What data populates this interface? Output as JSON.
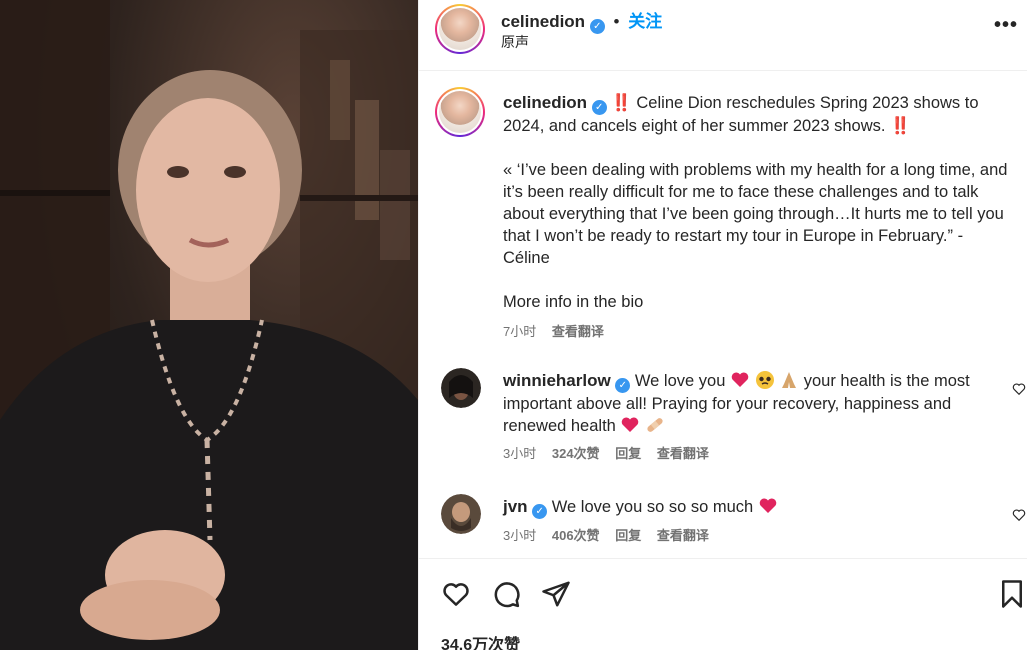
{
  "post": {
    "username": "celinedion",
    "follow_label": "关注",
    "audio_label": "原声",
    "caption_line1": "‼️ Celine Dion reschedules Spring 2023 shows to 2024, and cancels eight of her summer 2023 shows. ‼️",
    "caption_quote": "« ‘I’ve been dealing with problems with my health for a long time, and it’s been really difficult for me to face these challenges and to talk about everything that I’ve been going through…It hurts me to tell you that I won’t be ready to restart my tour in Europe in February.” - Céline",
    "caption_more": "More info in the bio",
    "time": "7小时",
    "see_translation": "查看翻译",
    "likes": "34.6万次赞"
  },
  "comments": [
    {
      "username": "winnieharlow",
      "text_before": "We love you",
      "text_after": "your health is the most important above all! Praying for your recovery, happiness and renewed health",
      "time": "3小时",
      "likes": "324次赞",
      "reply": "回复",
      "see_translation": "查看翻译"
    },
    {
      "username": "jvn",
      "text_before": "We love you so so so much",
      "time": "3小时",
      "likes": "406次赞",
      "reply": "回复",
      "see_translation": "查看翻译"
    }
  ],
  "icons": [
    "verified-badge-icon",
    "more-options-icon",
    "heart-icon",
    "comment-icon",
    "share-icon",
    "bookmark-icon"
  ],
  "colors": {
    "accent": "#0095f6",
    "verified": "#3897f0",
    "emoji_heart": "#e0245e"
  }
}
